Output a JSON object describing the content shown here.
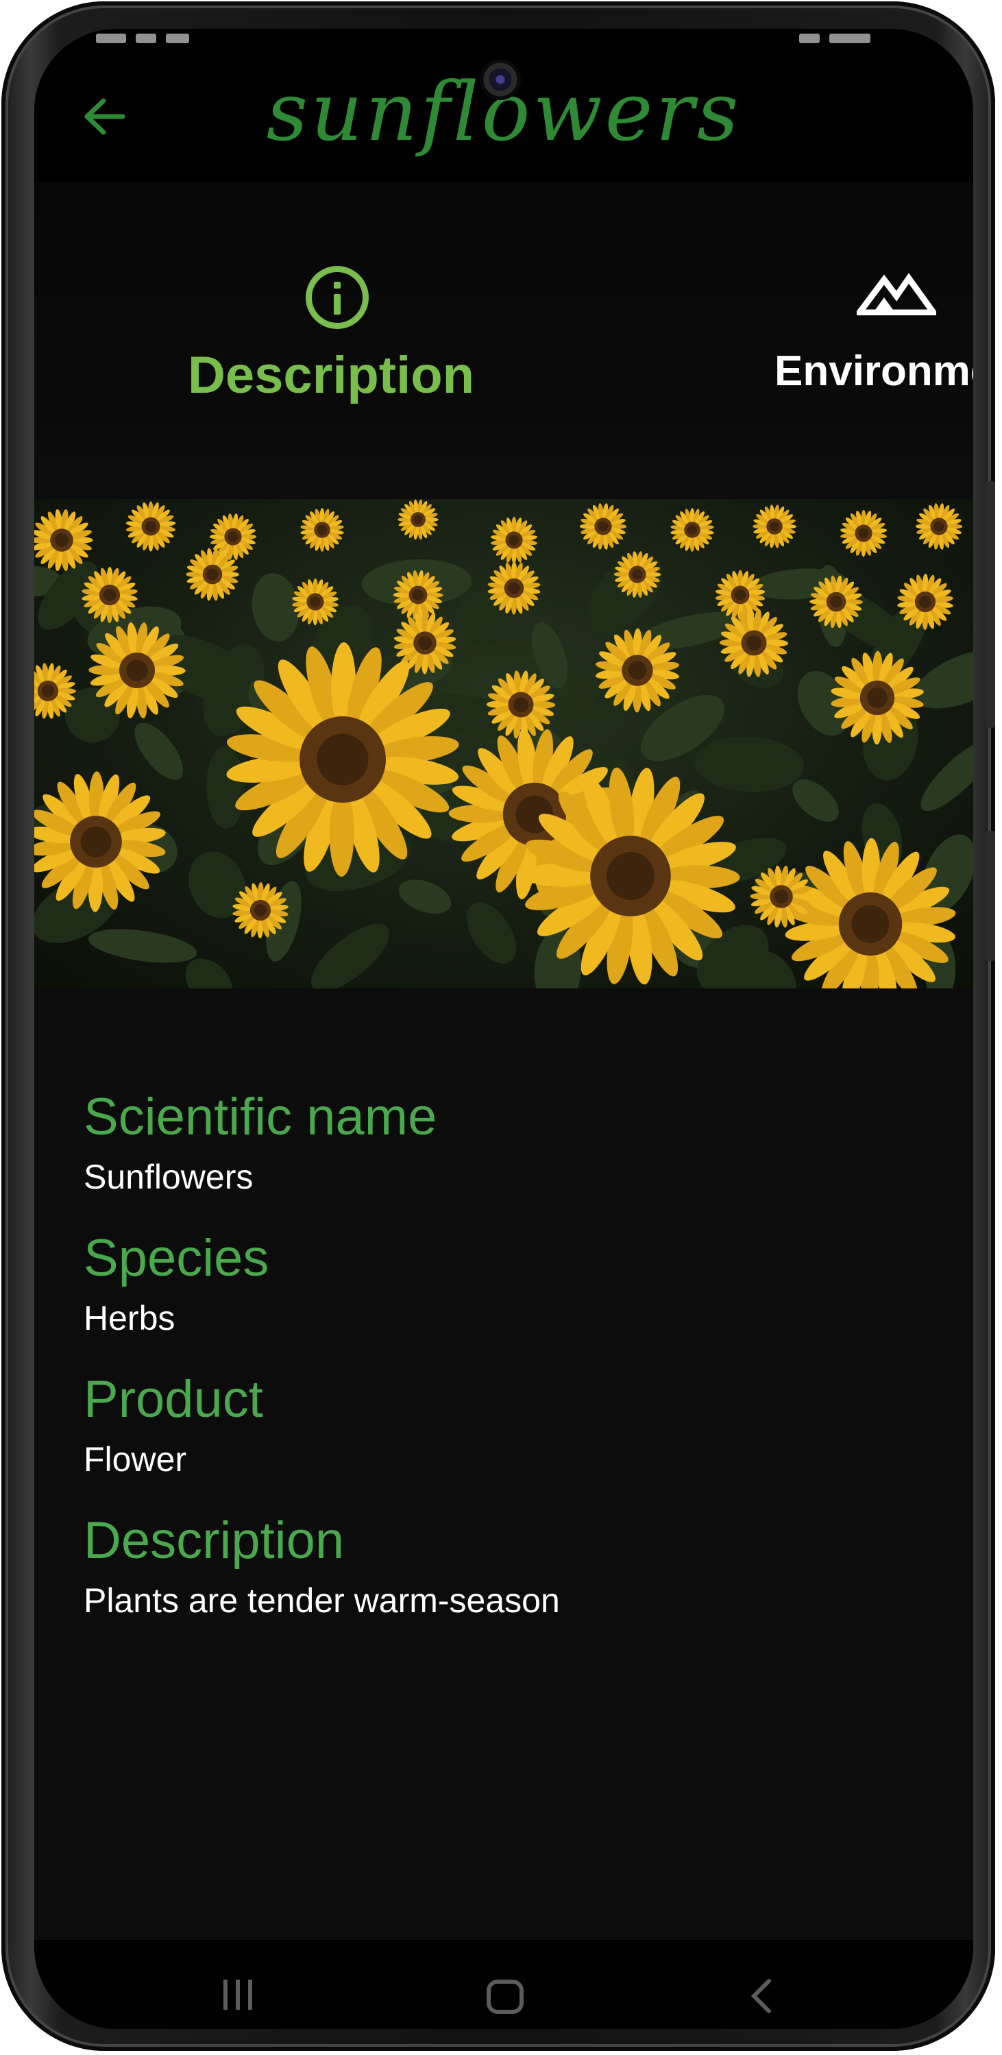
{
  "app": {
    "title": "sunflowers",
    "accent_color": "#79be4c",
    "label_color": "#4aa84d",
    "title_color": "#2f8a35"
  },
  "header": {
    "back_icon": "arrow-left-icon"
  },
  "tabs": [
    {
      "label": "Description",
      "icon": "info-circle-icon",
      "selected": true
    },
    {
      "label": "Environmer",
      "icon": "mountain-icon",
      "selected": false
    }
  ],
  "hero_image": {
    "subject": "sunflower field"
  },
  "details": {
    "scientific_name_label": "Scientific name",
    "scientific_name_value": "Sunflowers",
    "species_label": "Species",
    "species_value": "Herbs",
    "product_label": "Product",
    "product_value": "Flower",
    "description_label": "Description",
    "description_value": "Plants are tender warm-season"
  },
  "navbar": {
    "recents_icon": "recents-icon",
    "home_icon": "home-icon",
    "back_icon": "chevron-left-icon"
  }
}
